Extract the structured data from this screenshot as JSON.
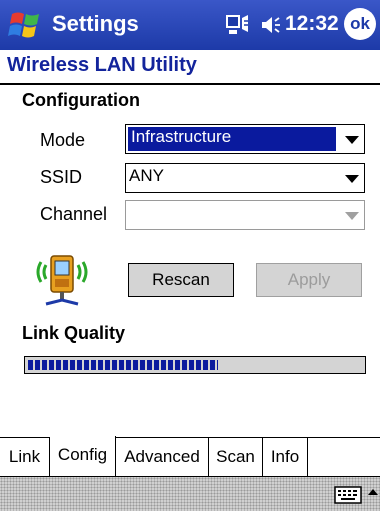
{
  "titlebar": {
    "title": "Settings",
    "time": "12:32",
    "ok_label": "ok",
    "icons": [
      "windows-start-icon",
      "connectivity-icon",
      "speaker-icon"
    ]
  },
  "app": {
    "title": "Wireless LAN Utility"
  },
  "configuration": {
    "heading": "Configuration",
    "mode": {
      "label": "Mode",
      "value": "Infrastructure"
    },
    "ssid": {
      "label": "SSID",
      "value": "ANY"
    },
    "channel": {
      "label": "Channel",
      "value": ""
    }
  },
  "buttons": {
    "rescan": "Rescan",
    "apply": "Apply"
  },
  "link_quality": {
    "heading": "Link Quality",
    "level_fraction": 0.57
  },
  "tabs": [
    {
      "label": "Link"
    },
    {
      "label": "Config",
      "active": true
    },
    {
      "label": "Advanced"
    },
    {
      "label": "Scan"
    },
    {
      "label": "Info"
    }
  ],
  "colors": {
    "titlebar": "#1d3aa8",
    "selection": "#0a1a9e",
    "app_title": "#13249c",
    "button_face": "#d4d4d4"
  }
}
